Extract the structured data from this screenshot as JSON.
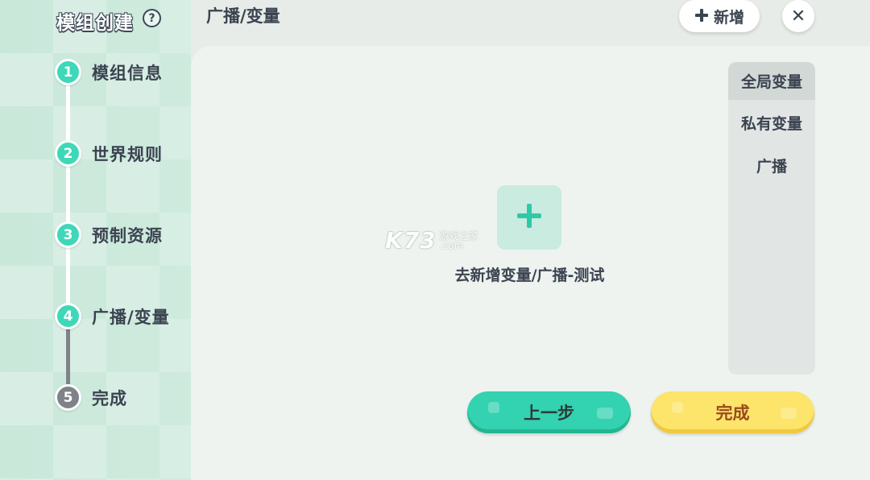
{
  "sidebar": {
    "title": "模组创建",
    "help_icon": "?",
    "steps": [
      {
        "num": "1",
        "label": "模组信息",
        "status": "done"
      },
      {
        "num": "2",
        "label": "世界规则",
        "status": "done"
      },
      {
        "num": "3",
        "label": "预制资源",
        "status": "done"
      },
      {
        "num": "4",
        "label": "广播/变量",
        "status": "current"
      },
      {
        "num": "5",
        "label": "完成",
        "status": "pending"
      }
    ]
  },
  "header": {
    "title": "广播/变量",
    "add_label": "新增",
    "close_icon": "✕"
  },
  "tabs": [
    {
      "label": "全局变量",
      "active": true
    },
    {
      "label": "私有变量",
      "active": false
    },
    {
      "label": "广播",
      "active": false
    }
  ],
  "empty_state": {
    "text": "去新增变量/广播-测试"
  },
  "watermark": {
    "main": "K73",
    "sub1": "游戏之家",
    "sub2": ".com"
  },
  "footer": {
    "prev_label": "上一步",
    "done_label": "完成"
  },
  "colors": {
    "accent_teal": "#33d2b0",
    "accent_yellow": "#fde46a",
    "step_inactive": "#7f8289",
    "text_dark": "#3b4350"
  }
}
